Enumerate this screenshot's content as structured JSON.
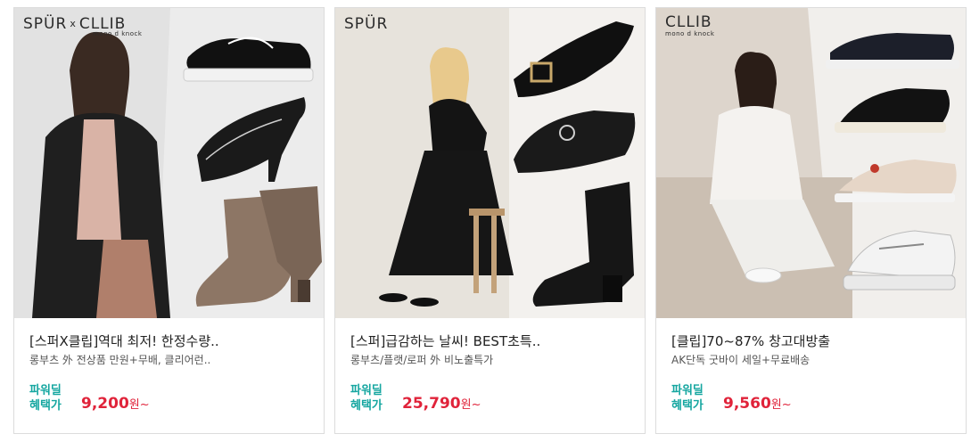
{
  "products": [
    {
      "brand_main": "SPÜR",
      "brand_x": "x",
      "brand_collab": "CLLIB",
      "brand_collab_sub": "mono d knock",
      "title": "[스퍼X클립]역대 최저! 한정수량..",
      "subtitle": "롱부츠 外 전상품 만원+무배, 클리어런..",
      "price_label_1": "파워딜",
      "price_label_2": "혜택가",
      "price": "9,200",
      "price_unit": "원~"
    },
    {
      "brand_main": "SPÜR",
      "title": "[스퍼]급감하는 날씨! BEST초특..",
      "subtitle": "롱부츠/플랫/로퍼 外 비노출특가",
      "price_label_1": "파워딜",
      "price_label_2": "혜택가",
      "price": "25,790",
      "price_unit": "원~"
    },
    {
      "brand_collab": "CLLIB",
      "brand_collab_sub": "mono d knock",
      "title": "[클립]70~87% 창고대방출",
      "subtitle": "AK단독 굿바이 세일+무료배송",
      "price_label_1": "파워딜",
      "price_label_2": "혜택가",
      "price": "9,560",
      "price_unit": "원~"
    }
  ],
  "colors": {
    "accent_teal": "#15a6a0",
    "price_red": "#e0233a",
    "border": "#dcdcdc"
  }
}
